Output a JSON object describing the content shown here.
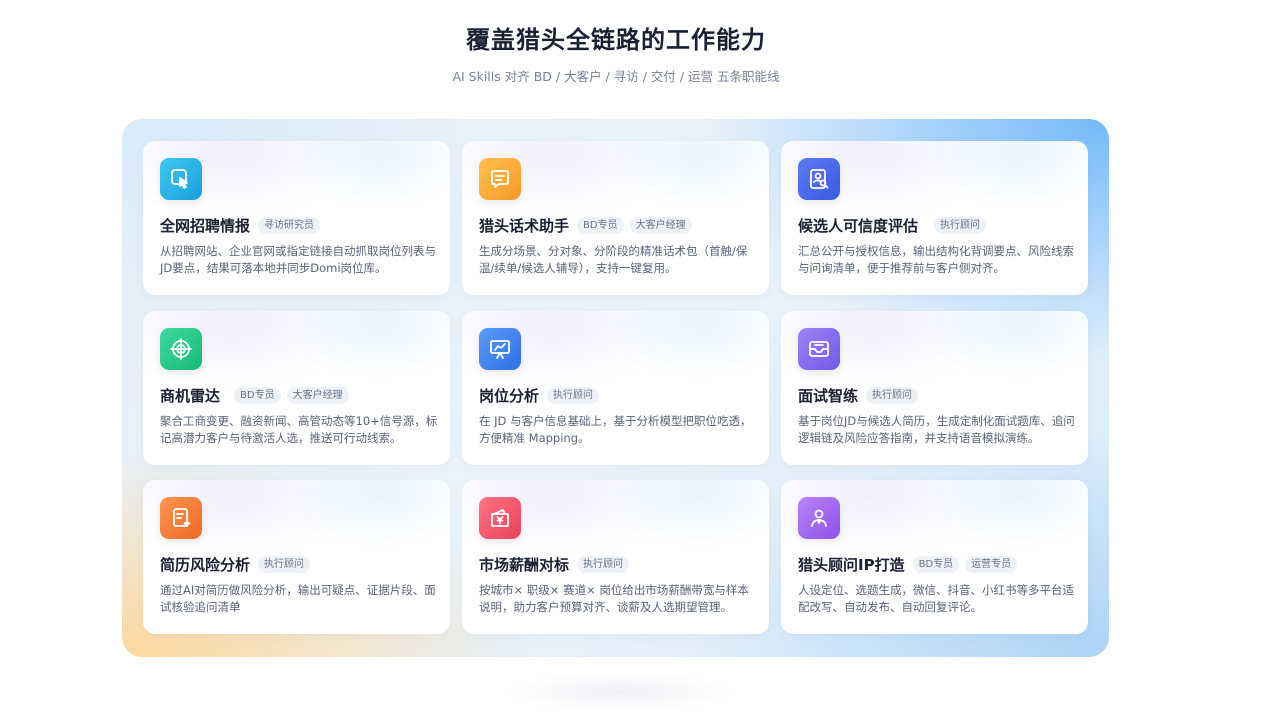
{
  "header": {
    "title": "覆盖猎头全链路的工作能力",
    "subtitle": "AI Skills 对齐 BD / 大客户 / 寻访 / 交付 / 运营 五条职能线"
  },
  "cards": [
    {
      "title": "全网招聘情报",
      "tags": [
        "寻访研究员"
      ],
      "desc": "从招聘网站、企业官网或指定链接自动抓取岗位列表与JD要点，结果可落本地并同步Domi岗位库。",
      "icon": "touch-pointer-icon",
      "color": "#2fb7e8"
    },
    {
      "title": "猎头话术助手",
      "tags": [
        "BD专员",
        "大客户经理"
      ],
      "desc": "生成分场景、分对象、分阶段的精准话术包（首触/保温/续单/候选人辅导），支持一键复用。",
      "icon": "chat-bubble-icon",
      "color": "#f6a53a"
    },
    {
      "title": "候选人可信度评估",
      "tags": [
        "执行顾问"
      ],
      "desc": "汇总公开与授权信息，输出结构化背调要点、风险线索与问询清单，便于推荐前与客户侧对齐。",
      "icon": "profile-search-icon",
      "color": "#4f6ff0"
    },
    {
      "title": "商机雷达",
      "tags": [
        "BD专员",
        "大客户经理"
      ],
      "desc": "聚合工商变更、融资新闻、高管动态等10+信号源，标记高潜力客户与待激活人选，推送可行动线索。",
      "icon": "radar-target-icon",
      "color": "#27c98a"
    },
    {
      "title": "岗位分析",
      "tags": [
        "执行顾问"
      ],
      "desc": "在 JD 与客户信息基础上，基于分析模型把职位吃透，方便精准 Mapping。",
      "icon": "presentation-chart-icon",
      "color": "#3f83f0"
    },
    {
      "title": "面试智练",
      "tags": [
        "执行顾问"
      ],
      "desc": "基于岗位JD与候选人简历，生成定制化面试题库、追问逻辑链及风险应答指南，并支持语音模拟演练。",
      "icon": "mail-tray-icon",
      "color": "#8a6ff2"
    },
    {
      "title": "简历风险分析",
      "tags": [
        "执行顾问"
      ],
      "desc": "通过AI对简历做风险分析，输出可疑点、证据片段、面试核验追问清单",
      "icon": "document-sparkle-icon",
      "color": "#f57a35"
    },
    {
      "title": "市场薪酬对标",
      "tags": [
        "执行顾问"
      ],
      "desc": "按城市× 职级× 赛道× 岗位给出市场薪酬带宽与样本说明，助力客户预算对齐、谈薪及人选期望管理。",
      "icon": "wallet-yuan-icon",
      "color": "#f0586a"
    },
    {
      "title": "猎头顾问IP打造",
      "tags": [
        "BD专员",
        "运营专员"
      ],
      "desc": "人设定位、选题生成，微信、抖音、小红书等多平台适配改写、自动发布、自动回复评论。",
      "icon": "person-badge-icon",
      "color": "#a466f0"
    }
  ]
}
